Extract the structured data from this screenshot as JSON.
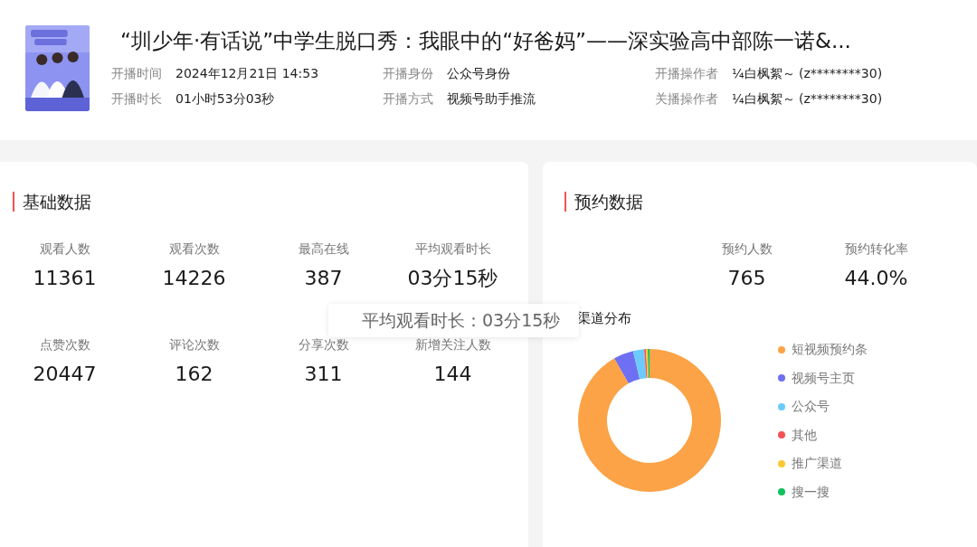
{
  "live": {
    "title": "“圳少年·有话说”中学生脱口秀：我眼中的“好爸妈”——深实验高中部陈一诺&...",
    "info": [
      {
        "label": "开播时间",
        "value": "2024年12月21日 14:53"
      },
      {
        "label": "开播身份",
        "value": "公众号身份"
      },
      {
        "label": "开播操作者",
        "value": "¼白枫絮～ (z********30)"
      },
      {
        "label": "开播时长",
        "value": "01小时53分03秒"
      },
      {
        "label": "开播方式",
        "value": "视频号助手推流"
      },
      {
        "label": "关播操作者",
        "value": "¼白枫絮～ (z********30)"
      }
    ]
  },
  "basic_data": {
    "title": "基础数据",
    "metrics": [
      {
        "label": "观看人数",
        "value": "11361"
      },
      {
        "label": "观看次数",
        "value": "14226"
      },
      {
        "label": "最高在线",
        "value": "387"
      },
      {
        "label": "平均观看时长",
        "value": "03分15秒"
      },
      {
        "label": "点赞次数",
        "value": "20447"
      },
      {
        "label": "评论次数",
        "value": "162"
      },
      {
        "label": "分享次数",
        "value": "311"
      },
      {
        "label": "新增关注人数",
        "value": "144"
      }
    ],
    "tooltip": "平均观看时长：03分15秒"
  },
  "reservation_data": {
    "title": "预约数据",
    "metrics": [
      {
        "label": "预约人数",
        "value": "765"
      },
      {
        "label": "预约转化率",
        "value": "44.0%"
      }
    ],
    "channel_title": "渠道分布",
    "legend": [
      {
        "label": "短视频预约条",
        "color": "#fba346"
      },
      {
        "label": "视频号主页",
        "color": "#6e6ff2"
      },
      {
        "label": "公众号",
        "color": "#6ccbfc"
      },
      {
        "label": "其他",
        "color": "#f25356"
      },
      {
        "label": "推广渠道",
        "color": "#fcc932"
      },
      {
        "label": "搜一搜",
        "color": "#10c15e"
      }
    ]
  }
}
